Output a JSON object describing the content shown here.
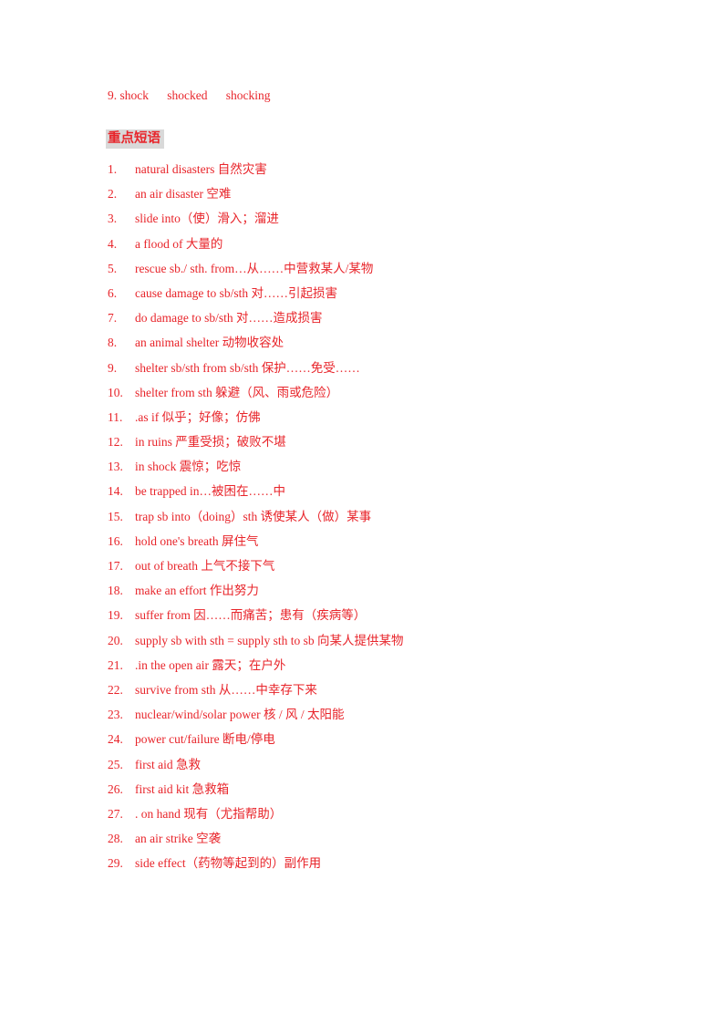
{
  "page": {
    "background_color": "#ffffff",
    "text_color": "#e8242a",
    "highlight_color": "#d9d9d9"
  },
  "top_line": {
    "text": "9. shock      shocked      shocking"
  },
  "section": {
    "heading": "重点短语"
  },
  "phrases": [
    {
      "num": "1.",
      "text": "natural disasters  自然灾害"
    },
    {
      "num": "2.",
      "text": "an air disaster  空难"
    },
    {
      "num": "3.",
      "text": "slide into（使）滑入；溜进"
    },
    {
      "num": "4.",
      "text": "a flood of  大量的"
    },
    {
      "num": "5.",
      "text": "rescue sb./ sth. from…从……中营救某人/某物"
    },
    {
      "num": "6.",
      "text": "cause damage to sb/sth 对……引起损害"
    },
    {
      "num": "7.",
      "text": "do damage to sb/sth 对……造成损害"
    },
    {
      "num": "8.",
      "text": "an animal shelter  动物收容处"
    },
    {
      "num": "9.",
      "text": "shelter sb/sth from sb/sth 保护……免受……"
    },
    {
      "num": "10.",
      "text": "shelter from sth 躲避（风、雨或危险）"
    },
    {
      "num": "11.",
      "text": ".as if  似乎；好像；仿佛"
    },
    {
      "num": "12.",
      "text": "in ruins 严重受损；破败不堪"
    },
    {
      "num": "13.",
      "text": "in shock  震惊；吃惊"
    },
    {
      "num": "14.",
      "text": "be trapped in…被困在……中"
    },
    {
      "num": "15.",
      "text": "trap sb into（doing）sth 诱使某人（做）某事"
    },
    {
      "num": "16.",
      "text": "hold one's breath  屏住气"
    },
    {
      "num": "17.",
      "text": "out of breath  上气不接下气"
    },
    {
      "num": "18.",
      "text": "make an effort  作出努力"
    },
    {
      "num": "19.",
      "text": "suffer from  因……而痛苦；患有（疾病等）"
    },
    {
      "num": "20.",
      "text": "supply sb with sth = supply sth to sb 向某人提供某物"
    },
    {
      "num": "21.",
      "text": ".in the open air    露天；在户外"
    },
    {
      "num": "22.",
      "text": "survive from sth 从……中幸存下来"
    },
    {
      "num": "23.",
      "text": "nuclear/wind/solar power  核 / 风 / 太阳能"
    },
    {
      "num": "24.",
      "text": "power cut/failure 断电/停电"
    },
    {
      "num": "25.",
      "text": "first aid  急救"
    },
    {
      "num": "26.",
      "text": "first aid kit  急救箱"
    },
    {
      "num": "27.",
      "text": ". on hand 现有（尤指帮助）"
    },
    {
      "num": "28.",
      "text": "an air strike  空袭"
    },
    {
      "num": "29.",
      "text": "side effect（药物等起到的）副作用"
    }
  ]
}
